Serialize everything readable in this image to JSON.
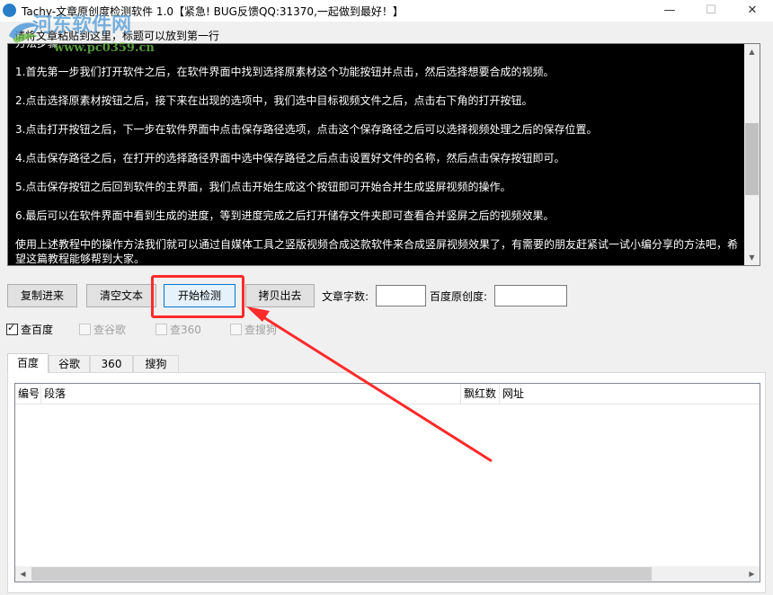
{
  "window": {
    "title": "Tachy-文章原创度检测软件 1.0【紧急! BUG反馈QQ:31370,一起做到最好！】",
    "minimize_glyph": "—",
    "maximize_glyph": "☐",
    "close_glyph": "✕"
  },
  "watermark": {
    "site_name": "河东软件网",
    "site_url": "www.pc0359.cn"
  },
  "hint_label": "请将文章粘贴到这里，标题可以放到第一行",
  "article": {
    "paragraphs": [
      "方法步骤",
      "1.首先第一步我们打开软件之后，在软件界面中找到选择原素材这个功能按钮并点击，然后选择想要合成的视频。",
      "2.点击选择原素材按钮之后，接下来在出现的选项中，我们选中目标视频文件之后，点击右下角的打开按钮。",
      "3.点击打开按钮之后，下一步在软件界面中点击保存路径选项，点击这个保存路径之后可以选择视频处理之后的保存位置。",
      "4.点击保存路径之后，在打开的选择路径界面中选中保存路径之后点击设置好文件的名称，然后点击保存按钮即可。",
      "5.点击保存按钮之后回到软件的主界面，我们点击开始生成这个按钮即可开始合并生成竖屏视频的操作。",
      "6.最后可以在软件界面中看到生成的进度，等到进度完成之后打开储存文件夹即可查看合并竖屏之后的视频效果。",
      "使用上述教程中的操作方法我们就可以通过自媒体工具之竖版视频合成这款软件来合成竖屏视频效果了，有需要的朋友赶紧试一试小编分享的方法吧，希望这篇教程能够帮到大家。"
    ]
  },
  "toolbar": {
    "copy_in_label": "复制进来",
    "clear_label": "清空文本",
    "start_label": "开始检测",
    "copy_out_label": "拷贝出去",
    "wordcount_label": "文章字数:",
    "wordcount_value": "",
    "originality_label": "百度原创度:",
    "originality_value": ""
  },
  "checkboxes": [
    {
      "label": "查百度",
      "checked": true,
      "enabled": true
    },
    {
      "label": "查谷歌",
      "checked": false,
      "enabled": false
    },
    {
      "label": "查360",
      "checked": false,
      "enabled": false
    },
    {
      "label": "查搜狗",
      "checked": false,
      "enabled": false
    }
  ],
  "tabs": [
    {
      "label": "百度",
      "active": true
    },
    {
      "label": "谷歌",
      "active": false
    },
    {
      "label": "360",
      "active": false
    },
    {
      "label": "搜狗",
      "active": false
    }
  ],
  "results_table": {
    "columns": [
      "编号",
      "段落",
      "飘红数",
      "网址"
    ],
    "rows": []
  },
  "colors": {
    "highlight_red": "#ff2a2a",
    "textarea_bg": "#000000",
    "accent_blue": "#0078d7"
  }
}
